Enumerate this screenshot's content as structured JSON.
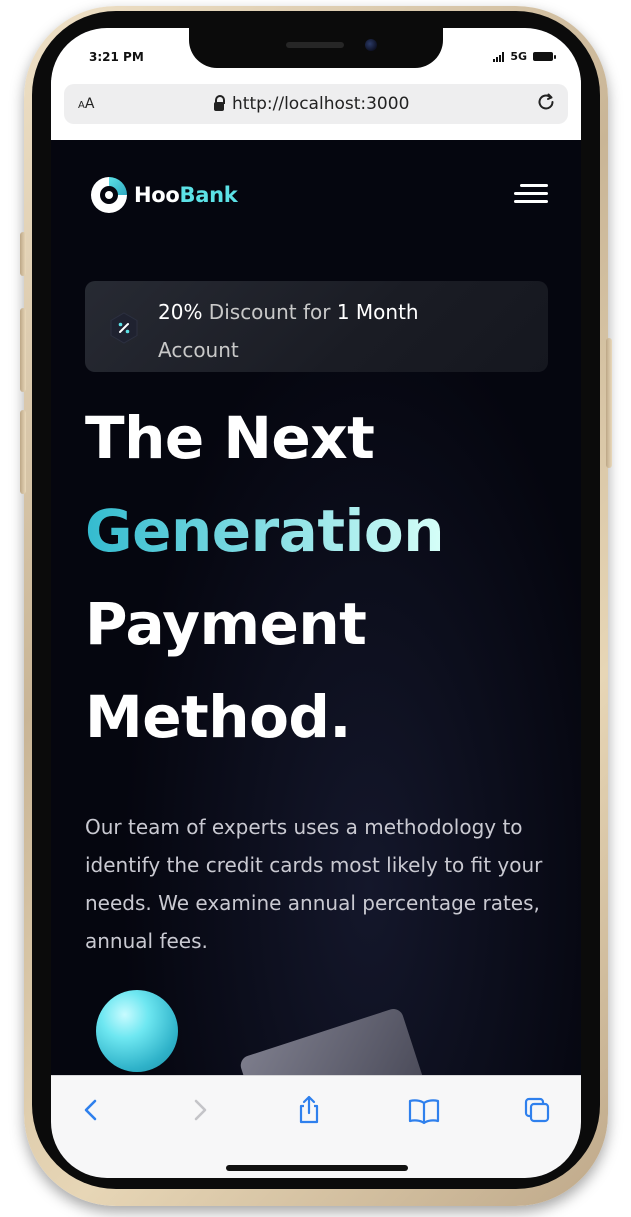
{
  "status_bar": {
    "time": "3:21 PM",
    "network": "5G"
  },
  "address_bar": {
    "text_size_label_small": "A",
    "text_size_label_large": "A",
    "url": "http://localhost:3000"
  },
  "header": {
    "logo_prefix": "Hoo",
    "logo_suffix": "Bank"
  },
  "promo": {
    "discount_value": "20%",
    "discount_middle": " Discount for ",
    "discount_period": "1 Month",
    "discount_end": "Account"
  },
  "hero": {
    "line1": "The Next",
    "line2": "Generation",
    "line3": "Payment",
    "line4": "Method.",
    "description": "Our team of experts uses a methodology to identify the credit cards most likely to fit your needs. We examine annual percentage rates, annual fees."
  },
  "colors": {
    "accent": "#5ce1e6",
    "page_background": "#05060f",
    "toolbar_icon": "#2f80ed",
    "toolbar_icon_disabled": "#c4c4c8"
  },
  "toolbar": {
    "icons": [
      "back-icon",
      "forward-icon",
      "share-icon",
      "bookmarks-icon",
      "tabs-icon"
    ]
  }
}
